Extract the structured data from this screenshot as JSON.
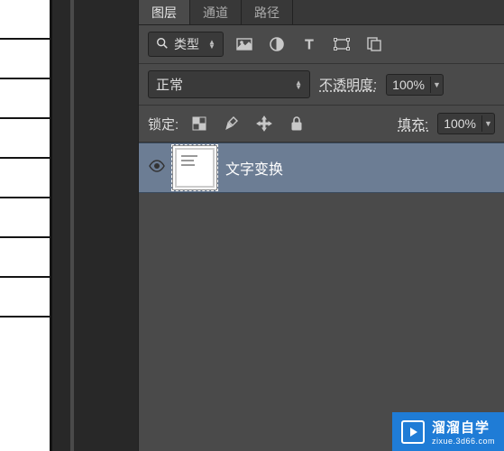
{
  "tabs": {
    "layers": "图层",
    "channels": "通道",
    "paths": "路径"
  },
  "filter": {
    "label": "类型"
  },
  "blend": {
    "mode": "正常"
  },
  "opacity": {
    "label": "不透明度:",
    "value": "100%"
  },
  "lock": {
    "label": "锁定:"
  },
  "fill": {
    "label": "填充:",
    "value": "100%"
  },
  "layer": {
    "name": "文字变换"
  },
  "watermark": {
    "title": "溜溜自学",
    "url": "zixue.3d66.com"
  }
}
